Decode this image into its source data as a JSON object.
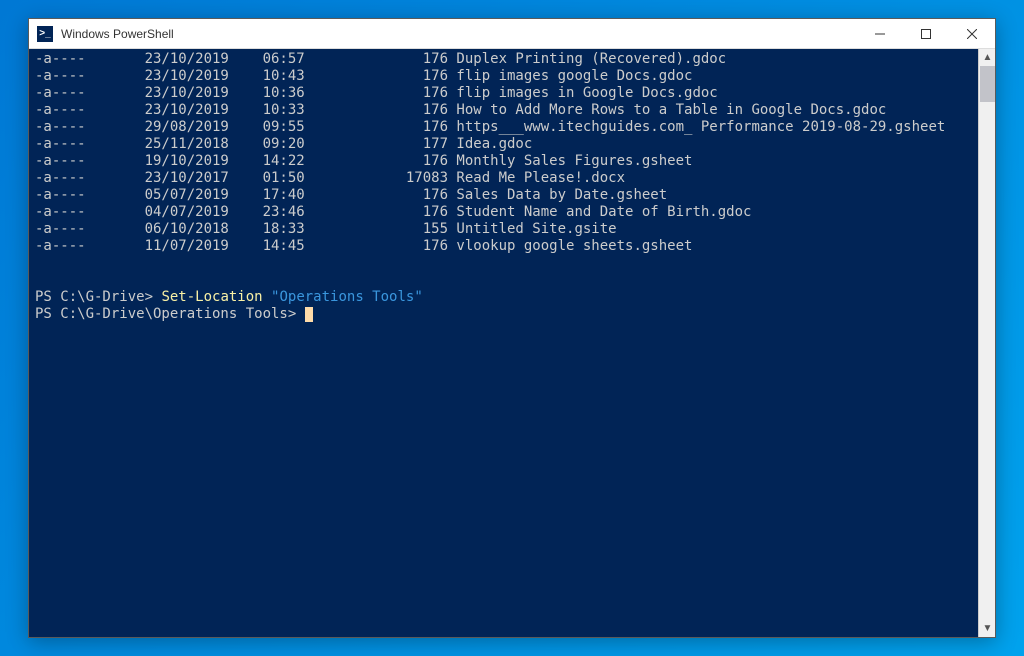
{
  "window": {
    "title": "Windows PowerShell"
  },
  "listing": [
    {
      "mode": "-a----",
      "date": "23/10/2019",
      "time": "06:57",
      "size": "176",
      "name": "Duplex Printing (Recovered).gdoc"
    },
    {
      "mode": "-a----",
      "date": "23/10/2019",
      "time": "10:43",
      "size": "176",
      "name": "flip images google Docs.gdoc"
    },
    {
      "mode": "-a----",
      "date": "23/10/2019",
      "time": "10:36",
      "size": "176",
      "name": "flip images in Google Docs.gdoc"
    },
    {
      "mode": "-a----",
      "date": "23/10/2019",
      "time": "10:33",
      "size": "176",
      "name": "How to Add More Rows to a Table in Google Docs.gdoc"
    },
    {
      "mode": "-a----",
      "date": "29/08/2019",
      "time": "09:55",
      "size": "176",
      "name": "https___www.itechguides.com_ Performance 2019-08-29.gsheet"
    },
    {
      "mode": "-a----",
      "date": "25/11/2018",
      "time": "09:20",
      "size": "177",
      "name": "Idea.gdoc"
    },
    {
      "mode": "-a----",
      "date": "19/10/2019",
      "time": "14:22",
      "size": "176",
      "name": "Monthly Sales Figures.gsheet"
    },
    {
      "mode": "-a----",
      "date": "23/10/2017",
      "time": "01:50",
      "size": "17083",
      "name": "Read Me Please!.docx"
    },
    {
      "mode": "-a----",
      "date": "05/07/2019",
      "time": "17:40",
      "size": "176",
      "name": "Sales Data by Date.gsheet"
    },
    {
      "mode": "-a----",
      "date": "04/07/2019",
      "time": "23:46",
      "size": "176",
      "name": "Student Name and Date of Birth.gdoc"
    },
    {
      "mode": "-a----",
      "date": "06/10/2018",
      "time": "18:33",
      "size": "155",
      "name": "Untitled Site.gsite"
    },
    {
      "mode": "-a----",
      "date": "11/07/2019",
      "time": "14:45",
      "size": "176",
      "name": "vlookup google sheets.gsheet"
    }
  ],
  "prompt1": {
    "prefix": "PS C:\\G-Drive> ",
    "command": "Set-Location",
    "arg": "\"Operations Tools\""
  },
  "prompt2": {
    "prefix": "PS C:\\G-Drive\\Operations Tools> "
  }
}
